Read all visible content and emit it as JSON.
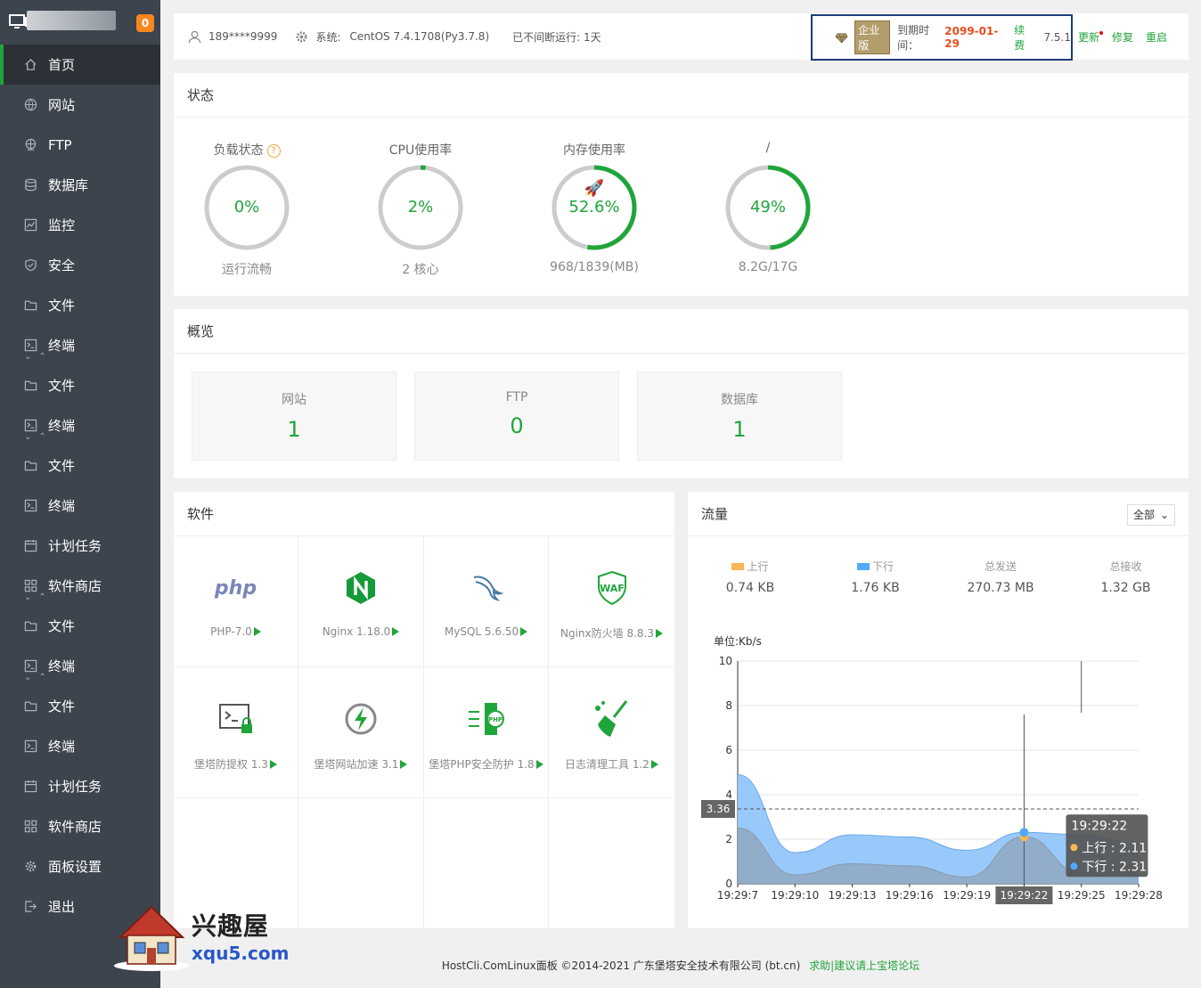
{
  "sidebar": {
    "badge": "0",
    "items": [
      {
        "label": "首页",
        "icon": "home-icon",
        "active": true
      },
      {
        "label": "网站",
        "icon": "globe-icon"
      },
      {
        "label": "FTP",
        "icon": "ftp-icon"
      },
      {
        "label": "数据库",
        "icon": "database-icon"
      },
      {
        "label": "监控",
        "icon": "monitor-icon"
      },
      {
        "label": "安全",
        "icon": "shield-icon"
      },
      {
        "label": "文件",
        "icon": "folder-icon"
      },
      {
        "label": "终端",
        "icon": "terminal-icon"
      },
      {
        "label": "文件",
        "icon": "folder-icon"
      },
      {
        "label": "终端",
        "icon": "terminal-icon"
      },
      {
        "label": "文件",
        "icon": "folder-icon"
      },
      {
        "label": "终端",
        "icon": "terminal-icon"
      },
      {
        "label": "计划任务",
        "icon": "calendar-icon"
      },
      {
        "label": "软件商店",
        "icon": "grid-icon"
      },
      {
        "label": "文件",
        "icon": "folder-icon"
      },
      {
        "label": "终端",
        "icon": "terminal-icon"
      },
      {
        "label": "文件",
        "icon": "folder-icon"
      },
      {
        "label": "终端",
        "icon": "terminal-icon"
      },
      {
        "label": "计划任务",
        "icon": "calendar-icon"
      },
      {
        "label": "软件商店",
        "icon": "grid-icon"
      },
      {
        "label": "面板设置",
        "icon": "settings-icon"
      },
      {
        "label": "退出",
        "icon": "logout-icon"
      }
    ]
  },
  "topbar": {
    "user": "189****9999",
    "system_label": "系统:",
    "system_value": "CentOS 7.4.1708(Py3.7.8)",
    "uptime": "已不间断运行: 1天",
    "edition": "企业版",
    "expire_label": "到期时间：",
    "expire_date": "2099-01-29",
    "renew": "续费",
    "version": "7.5.1",
    "update": "更新",
    "repair": "修复",
    "restart": "重启"
  },
  "status": {
    "title": "状态",
    "gauges": [
      {
        "label": "负载状态",
        "value": "0%",
        "sub": "运行流畅",
        "percent": 0
      },
      {
        "label": "CPU使用率",
        "value": "2%",
        "sub": "2 核心",
        "percent": 2
      },
      {
        "label": "内存使用率",
        "value": "52.6%",
        "sub": "968/1839(MB)",
        "percent": 52.6
      },
      {
        "label": "/",
        "value": "49%",
        "sub": "8.2G/17G",
        "percent": 49
      }
    ]
  },
  "overview": {
    "title": "概览",
    "cards": [
      {
        "label": "网站",
        "count": "1"
      },
      {
        "label": "FTP",
        "count": "0"
      },
      {
        "label": "数据库",
        "count": "1"
      }
    ]
  },
  "software": {
    "title": "软件",
    "items": [
      {
        "name": "PHP-7.0",
        "icon": "php-icon"
      },
      {
        "name": "Nginx 1.18.0",
        "icon": "nginx-icon"
      },
      {
        "name": "MySQL 5.6.50",
        "icon": "mysql-icon"
      },
      {
        "name": "Nginx防火墙 8.8.3",
        "icon": "waf-icon"
      },
      {
        "name": "堡塔防提权 1.3",
        "icon": "terminal-lock-icon"
      },
      {
        "name": "堡塔网站加速 3.1",
        "icon": "bolt-icon"
      },
      {
        "name": "堡塔PHP安全防护 1.8",
        "icon": "php-shield-icon"
      },
      {
        "name": "日志清理工具 1.2",
        "icon": "broom-icon"
      }
    ]
  },
  "traffic": {
    "title": "流量",
    "filter": "全部",
    "stats": [
      {
        "label": "上行",
        "value": "0.74 KB",
        "color": "#f7b851"
      },
      {
        "label": "下行",
        "value": "1.76 KB",
        "color": "#52a9ff"
      },
      {
        "label": "总发送",
        "value": "270.73 MB"
      },
      {
        "label": "总接收",
        "value": "1.32 GB"
      }
    ],
    "tooltip": {
      "time": "19:29:22",
      "up_label": "上行 : 2.11",
      "down_label": "下行 : 2.31"
    },
    "cursor_value": "3.36"
  },
  "chart_data": {
    "type": "area",
    "ylabel": "单位:Kb/s",
    "ylim": [
      0,
      10
    ],
    "yticks": [
      "0",
      "2",
      "4",
      "6",
      "8",
      "10"
    ],
    "x": [
      "19:29:7",
      "19:29:10",
      "19:29:13",
      "19:29:16",
      "19:29:19",
      "19:29:22",
      "19:29:25",
      "19:29:28"
    ],
    "series": [
      {
        "name": "上行",
        "color": "#f7b851",
        "values": [
          2.5,
          0.4,
          0.9,
          0.8,
          0.3,
          2.11,
          0.5,
          0.9
        ]
      },
      {
        "name": "下行",
        "color": "#52a9ff",
        "values": [
          4.9,
          1.4,
          2.2,
          2.1,
          1.5,
          2.31,
          2.2,
          1.8
        ]
      }
    ]
  },
  "footer": {
    "copyright": "HostCli.ComLinux面板 ©2014-2021 广东堡塔安全技术有限公司 (bt.cn)",
    "link": "求助|建议请上宝塔论坛"
  },
  "watermark": {
    "name": "兴趣屋",
    "url": "xqu5.com"
  }
}
